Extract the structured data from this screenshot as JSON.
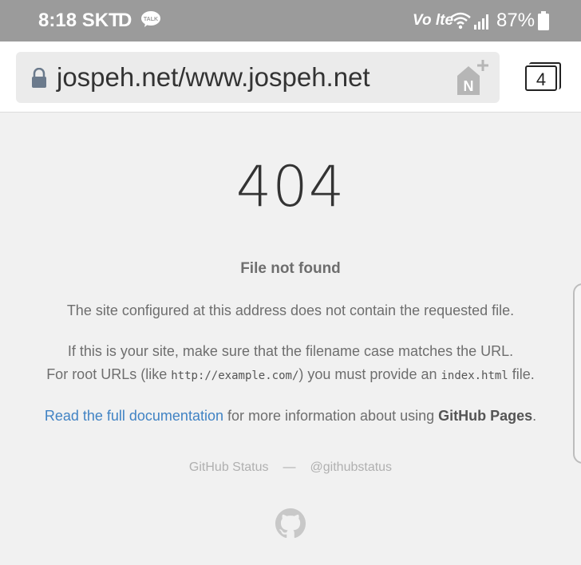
{
  "status_bar": {
    "time": "8:18 SKT",
    "d_label": "D",
    "talk_label": "TALK",
    "volte": "Vo lte",
    "battery_pct": "87%"
  },
  "browser": {
    "url": "jospeh.net/www.jospeh.net",
    "tab_count": "4",
    "naver_label": "N"
  },
  "page": {
    "code": "404",
    "heading": "File not found",
    "p1": "The site configured at this address does not contain the requested file.",
    "p2_line1": "If this is your site, make sure that the filename case matches the URL.",
    "p2_line2_a": "For root URLs (like ",
    "p2_code1": "http://example.com/",
    "p2_line2_b": ") you must provide an ",
    "p2_code2": "index.html",
    "p2_line2_c": " file.",
    "doc_link": "Read the full documentation",
    "p3_mid": " for more information about using ",
    "p3_strong": "GitHub Pages",
    "p3_end": ".",
    "footer_status": "GitHub Status",
    "footer_dash": "—",
    "footer_handle": "@githubstatus"
  },
  "colors": {
    "status_bar": "#9b9b9b",
    "link": "#4183c4",
    "text": "#6e6e6e",
    "background": "#f1f1f1"
  }
}
